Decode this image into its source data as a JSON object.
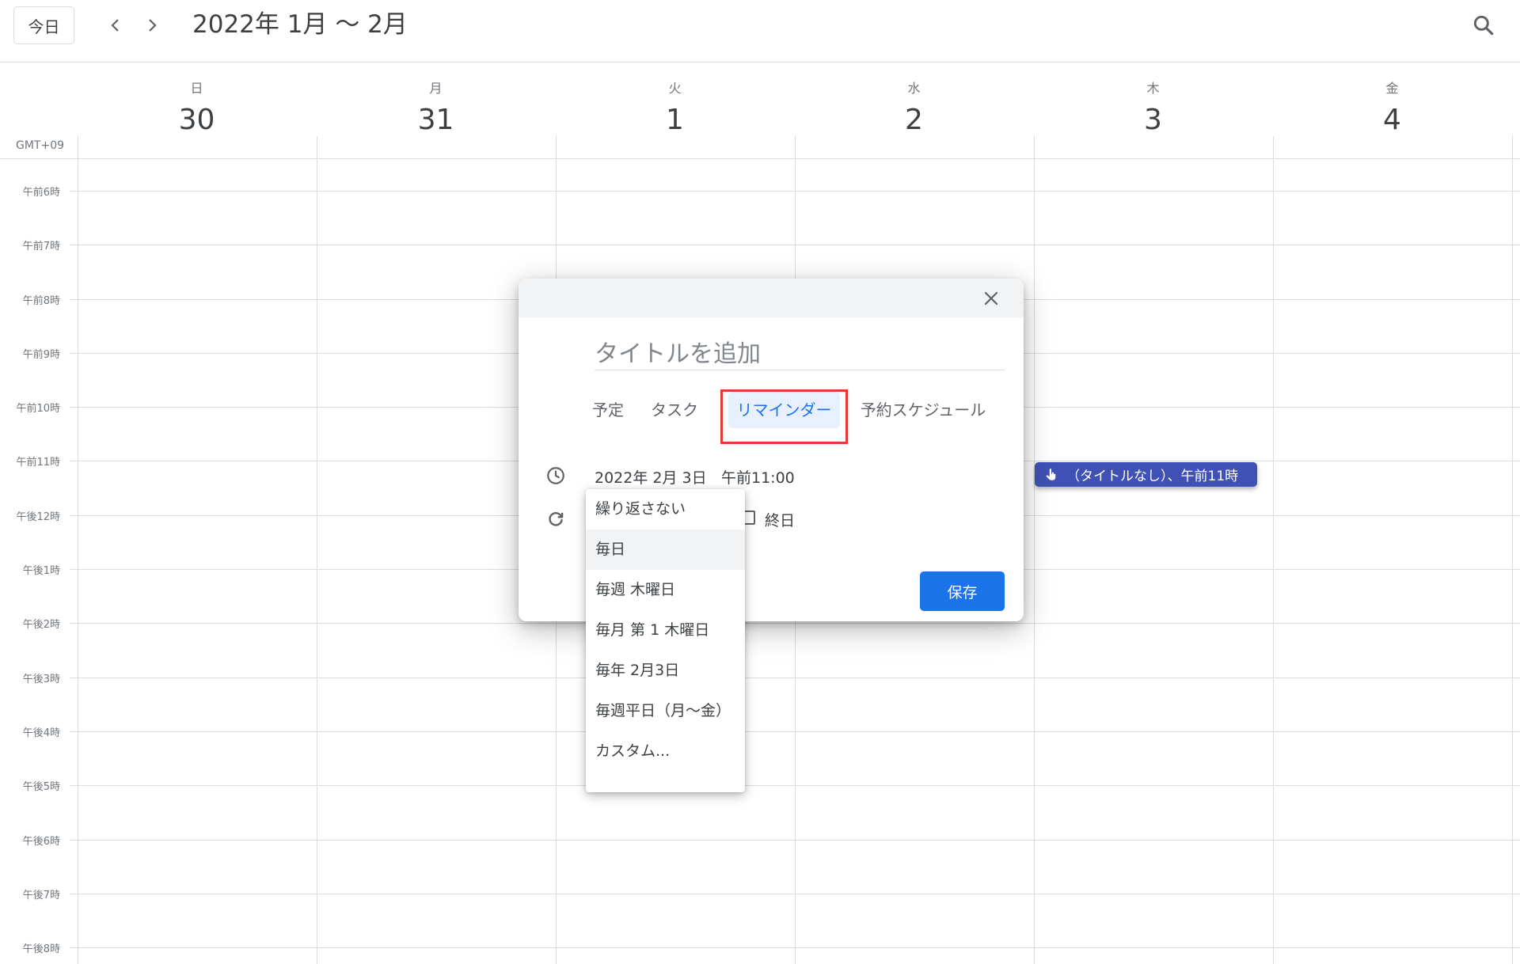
{
  "header": {
    "today_label": "今日",
    "date_range": "2022年 1月 〜 2月"
  },
  "timezone": "GMT+09",
  "days": [
    {
      "dow": "日",
      "num": "30"
    },
    {
      "dow": "月",
      "num": "31"
    },
    {
      "dow": "火",
      "num": "1"
    },
    {
      "dow": "水",
      "num": "2"
    },
    {
      "dow": "木",
      "num": "3"
    },
    {
      "dow": "金",
      "num": "4"
    }
  ],
  "hours": [
    "午前6時",
    "午前7時",
    "午前8時",
    "午前9時",
    "午前10時",
    "午前11時",
    "午後12時",
    "午後1時",
    "午後2時",
    "午後3時",
    "午後4時",
    "午後5時",
    "午後6時",
    "午後7時",
    "午後8時"
  ],
  "event_chip": {
    "label": "（タイトルなし）、午前11時",
    "icon": "hand-pointer-icon",
    "color": "#3f51b5"
  },
  "dialog": {
    "title_placeholder": "タイトルを追加",
    "tabs": [
      "予定",
      "タスク",
      "リマインダー",
      "予約スケジュール"
    ],
    "active_tab": "リマインダー",
    "date": "2022年 2月 3日",
    "time": "午前11:00",
    "all_day_label": "終日",
    "save_label": "保存"
  },
  "repeat_options": [
    "繰り返さない",
    "毎日",
    "毎週 木曜日",
    "毎月 第 1 木曜日",
    "毎年 2月3日",
    "毎週平日（月〜金）",
    "カスタム..."
  ],
  "colors": {
    "accent": "#1a73e8",
    "highlight_border": "#e53935",
    "grid_line": "#dadce0"
  }
}
